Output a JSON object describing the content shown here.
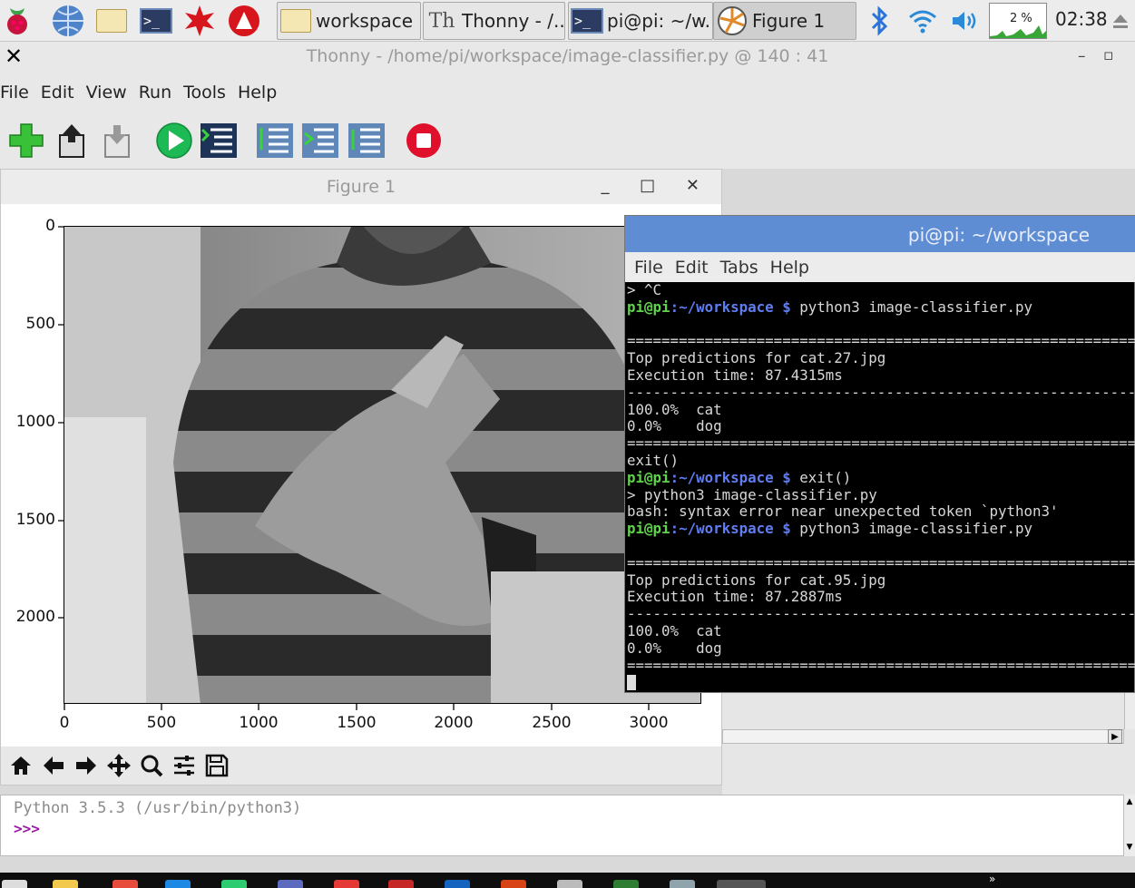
{
  "panel": {
    "tasks": [
      "workspace",
      "Thonny  -  /...",
      "pi@pi: ~/w...",
      "Figure 1"
    ],
    "cpu_label": "2 %",
    "clock": "02:38"
  },
  "thonny": {
    "close_glyph": "✕",
    "title": "Thonny  -  /home/pi/workspace/image-classifier.py  @  140 : 41",
    "win_min": "–",
    "win_restore": "▫",
    "menu": [
      "File",
      "Edit",
      "View",
      "Run",
      "Tools",
      "Help"
    ]
  },
  "figure": {
    "title": "Figure 1",
    "controls": "_ □ ✕",
    "y_ticks": [
      "0",
      "500",
      "1000",
      "1500",
      "2000"
    ],
    "x_ticks": [
      "0",
      "500",
      "1000",
      "1500",
      "2000",
      "2500",
      "3000"
    ]
  },
  "terminal": {
    "title": "pi@pi: ~/workspace",
    "menu": [
      "File",
      "Edit",
      "Tabs",
      "Help"
    ],
    "prompt_user": "pi@pi",
    "prompt_path": ":~/workspace $",
    "lines": {
      "l1": "> ^C",
      "cmd1": " python3 image-classifier.py",
      "sep": "===============================================================",
      "dash": "---------------------------------------------------------------",
      "top1": "Top predictions for cat.27.jpg",
      "exec1": "Execution time: 87.4315ms",
      "p1a": "100.0%  cat",
      "p1b": "0.0%    dog",
      "exitcall": "exit()",
      "cmd2": " exit()",
      "cont": "> python3 image-classifier.py",
      "bash": "bash: syntax error near unexpected token `python3'",
      "cmd3": " python3 image-classifier.py",
      "top2": "Top predictions for cat.95.jpg",
      "exec2": "Execution time: 87.2887ms",
      "p2a": "100.0%  cat",
      "p2b": "0.0%    dog"
    }
  },
  "shell": {
    "banner": "Python 3.5.3 (/usr/bin/python3)",
    "prompt": ">>>"
  },
  "icons": {
    "panel": [
      "raspberry-menu-icon",
      "web-browser-icon",
      "file-manager-icon",
      "terminal-icon",
      "mathematica-icon",
      "wolfram-icon",
      "bluetooth-icon",
      "wifi-icon",
      "volume-icon",
      "eject-icon"
    ],
    "toolbar": [
      "new-file-icon",
      "open-file-icon",
      "save-file-icon",
      "run-icon",
      "debug-icon",
      "step-over-icon",
      "step-into-icon",
      "step-out-icon",
      "stop-icon"
    ],
    "figure_nav": [
      "home-icon",
      "back-arrow-icon",
      "forward-arrow-icon",
      "pan-icon",
      "zoom-icon",
      "configure-subplots-icon",
      "save-figure-icon"
    ]
  },
  "colors": {
    "terminal_title_bar": "#5f8dd3",
    "prompt_user": "#5fd34b",
    "prompt_path": "#5f7df0",
    "run_button": "#1db954",
    "stop_button": "#e0102d",
    "shell_prompt": "#9d1aa8"
  }
}
